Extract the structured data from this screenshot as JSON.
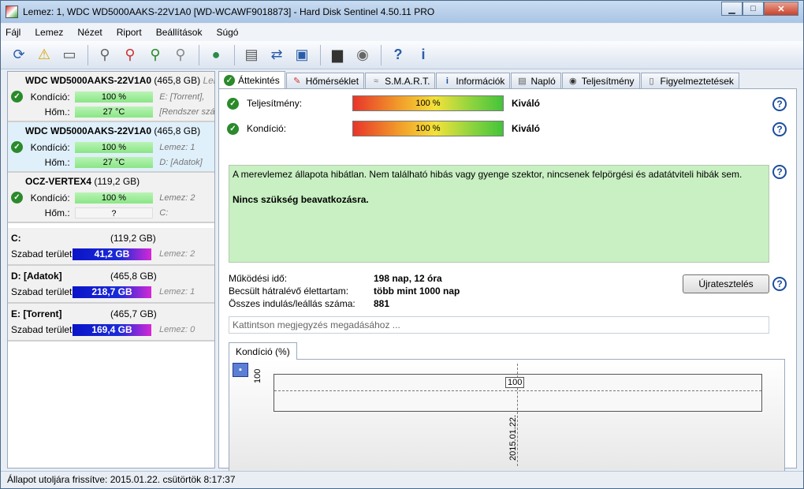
{
  "window": {
    "title": "Lemez: 1, WDC WD5000AAKS-22V1A0 [WD-WCAWF9018873]  -  Hard Disk Sentinel 4.50.11 PRO",
    "min": "▁",
    "max": "□",
    "close": "✕"
  },
  "menu": [
    "Fájl",
    "Lemez",
    "Nézet",
    "Riport",
    "Beállítások",
    "Súgó"
  ],
  "disks": [
    {
      "name": "WDC WD5000AAKS-22V1A0",
      "cap": "(465,8 GB)",
      "extra": "Lem",
      "cond_label": "Kondíció:",
      "cond": "100 %",
      "cond_side": "E: [Torrent],",
      "temp_label": "Hőm.:",
      "temp": "27 °C",
      "temp_side": "[Rendszer szá"
    },
    {
      "name": "WDC WD5000AAKS-22V1A0",
      "cap": "(465,8 GB)",
      "extra": "",
      "cond_label": "Kondíció:",
      "cond": "100 %",
      "cond_side": "Lemez: 1",
      "temp_label": "Hőm.:",
      "temp": "27 °C",
      "temp_side": "D: [Adatok]"
    },
    {
      "name": "OCZ-VERTEX4",
      "cap": "(119,2 GB)",
      "extra": "",
      "cond_label": "Kondíció:",
      "cond": "100 %",
      "cond_side": "Lemez: 2",
      "temp_label": "Hőm.:",
      "temp": "?",
      "temp_side": "C:"
    }
  ],
  "volumes": [
    {
      "name": "C:",
      "cap": "(119,2 GB)",
      "free_label": "Szabad terület",
      "free": "41,2 GB",
      "disk": "Lemez: 2"
    },
    {
      "name": "D: [Adatok]",
      "cap": "(465,8 GB)",
      "free_label": "Szabad terület",
      "free": "218,7 GB",
      "disk": "Lemez: 1"
    },
    {
      "name": "E: [Torrent]",
      "cap": "(465,7 GB)",
      "free_label": "Szabad terület",
      "free": "169,4 GB",
      "disk": "Lemez: 0"
    }
  ],
  "tabs": [
    "Áttekintés",
    "Hőmérséklet",
    "S.M.A.R.T.",
    "Információk",
    "Napló",
    "Teljesítmény",
    "Figyelmeztetések"
  ],
  "overview": {
    "perf_label": "Teljesítmény:",
    "perf_value": "100 %",
    "perf_grade": "Kiváló",
    "cond_label": "Kondíció:",
    "cond_value": "100 %",
    "cond_grade": "Kiváló",
    "message": "A merevlemez állapota hibátlan. Nem található hibás vagy gyenge szektor, nincsenek felpörgési és adatátviteli hibák sem.",
    "message_bold": "Nincs szükség beavatkozásra.",
    "uptime_label": "Működési idő:",
    "uptime": "198 nap, 12 óra",
    "life_label": "Becsült hátralévő élettartam:",
    "life": "több mint 1000 nap",
    "starts_label": "Összes indulás/leállás száma:",
    "starts": "881",
    "retest": "Újratesztelés",
    "note_placeholder": "Kattintson megjegyzés megadásához ...",
    "chart_tab": "Kondíció  (%)",
    "help": "?"
  },
  "chart_data": {
    "type": "line",
    "x": [
      "2015.01.22."
    ],
    "values": [
      100
    ],
    "ylabel": "100",
    "point_label": "100"
  },
  "status": "Állapot utoljára frissítve: 2015.01.22. csütörtök 8:17:37"
}
